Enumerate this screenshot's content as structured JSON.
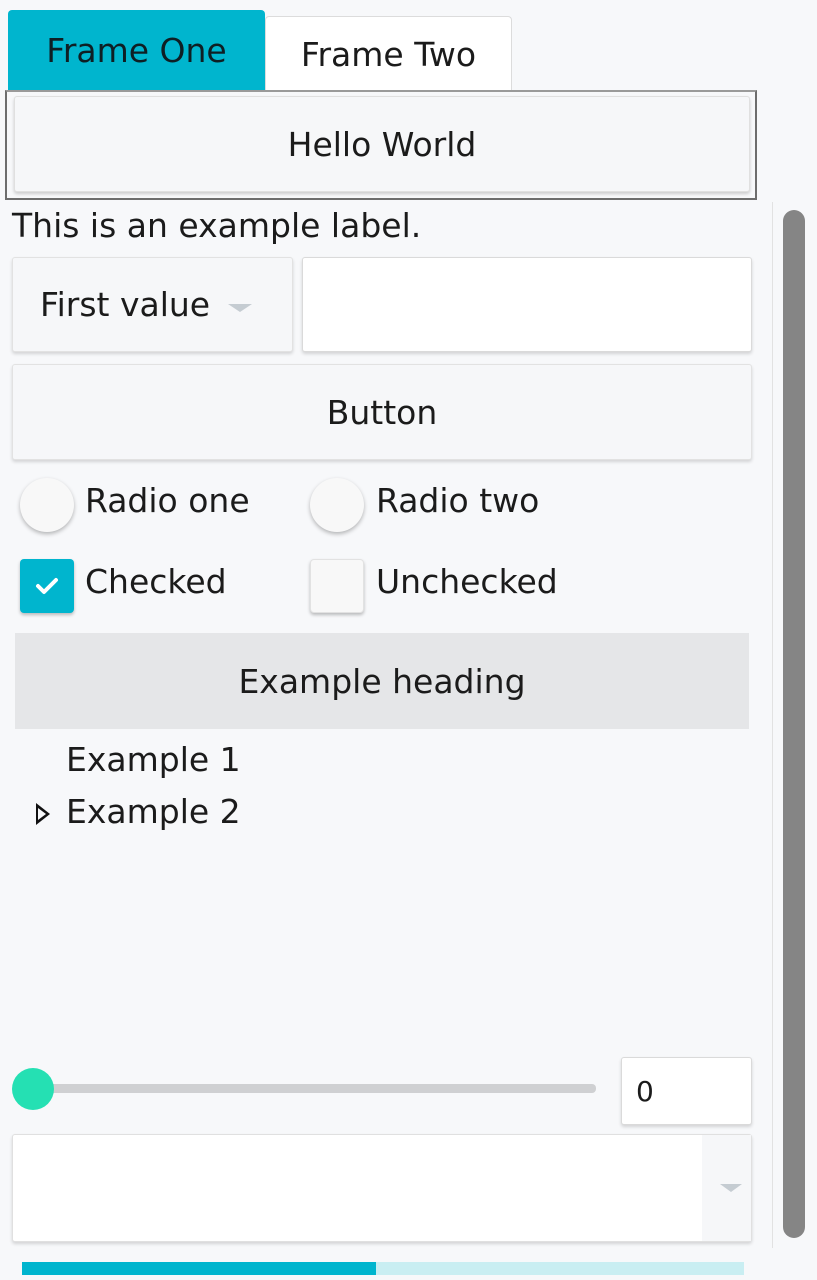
{
  "tabs": [
    {
      "label": "Frame One",
      "active": true
    },
    {
      "label": "Frame Two",
      "active": false
    }
  ],
  "frame_one": {
    "hello_button": "Hello World",
    "label": "This is an example label.",
    "combo": {
      "selected": "First value"
    },
    "entry": {
      "value": ""
    },
    "button": "Button",
    "radios": [
      {
        "label": "Radio one",
        "selected": false
      },
      {
        "label": "Radio two",
        "selected": false
      }
    ],
    "checkboxes": [
      {
        "label": "Checked",
        "checked": true
      },
      {
        "label": "Unchecked",
        "checked": false
      }
    ],
    "heading": "Example heading",
    "tree": [
      {
        "label": "Example 1",
        "expandable": false
      },
      {
        "label": "Example 2",
        "expandable": true
      }
    ],
    "slider": {
      "value": 0
    },
    "spinbox": {
      "value": "0"
    },
    "combo2": {
      "selected": ""
    },
    "progress": {
      "fraction": 0.49
    }
  },
  "colors": {
    "accent": "#00b5ce",
    "slider_thumb": "#25e0b3",
    "progress_track": "#c9eef2",
    "heading_bg": "#e5e6e8"
  },
  "icons": {
    "combo_arrow": "chevron-down-icon",
    "tree_expander": "triangle-right-icon",
    "check": "checkmark-icon"
  }
}
